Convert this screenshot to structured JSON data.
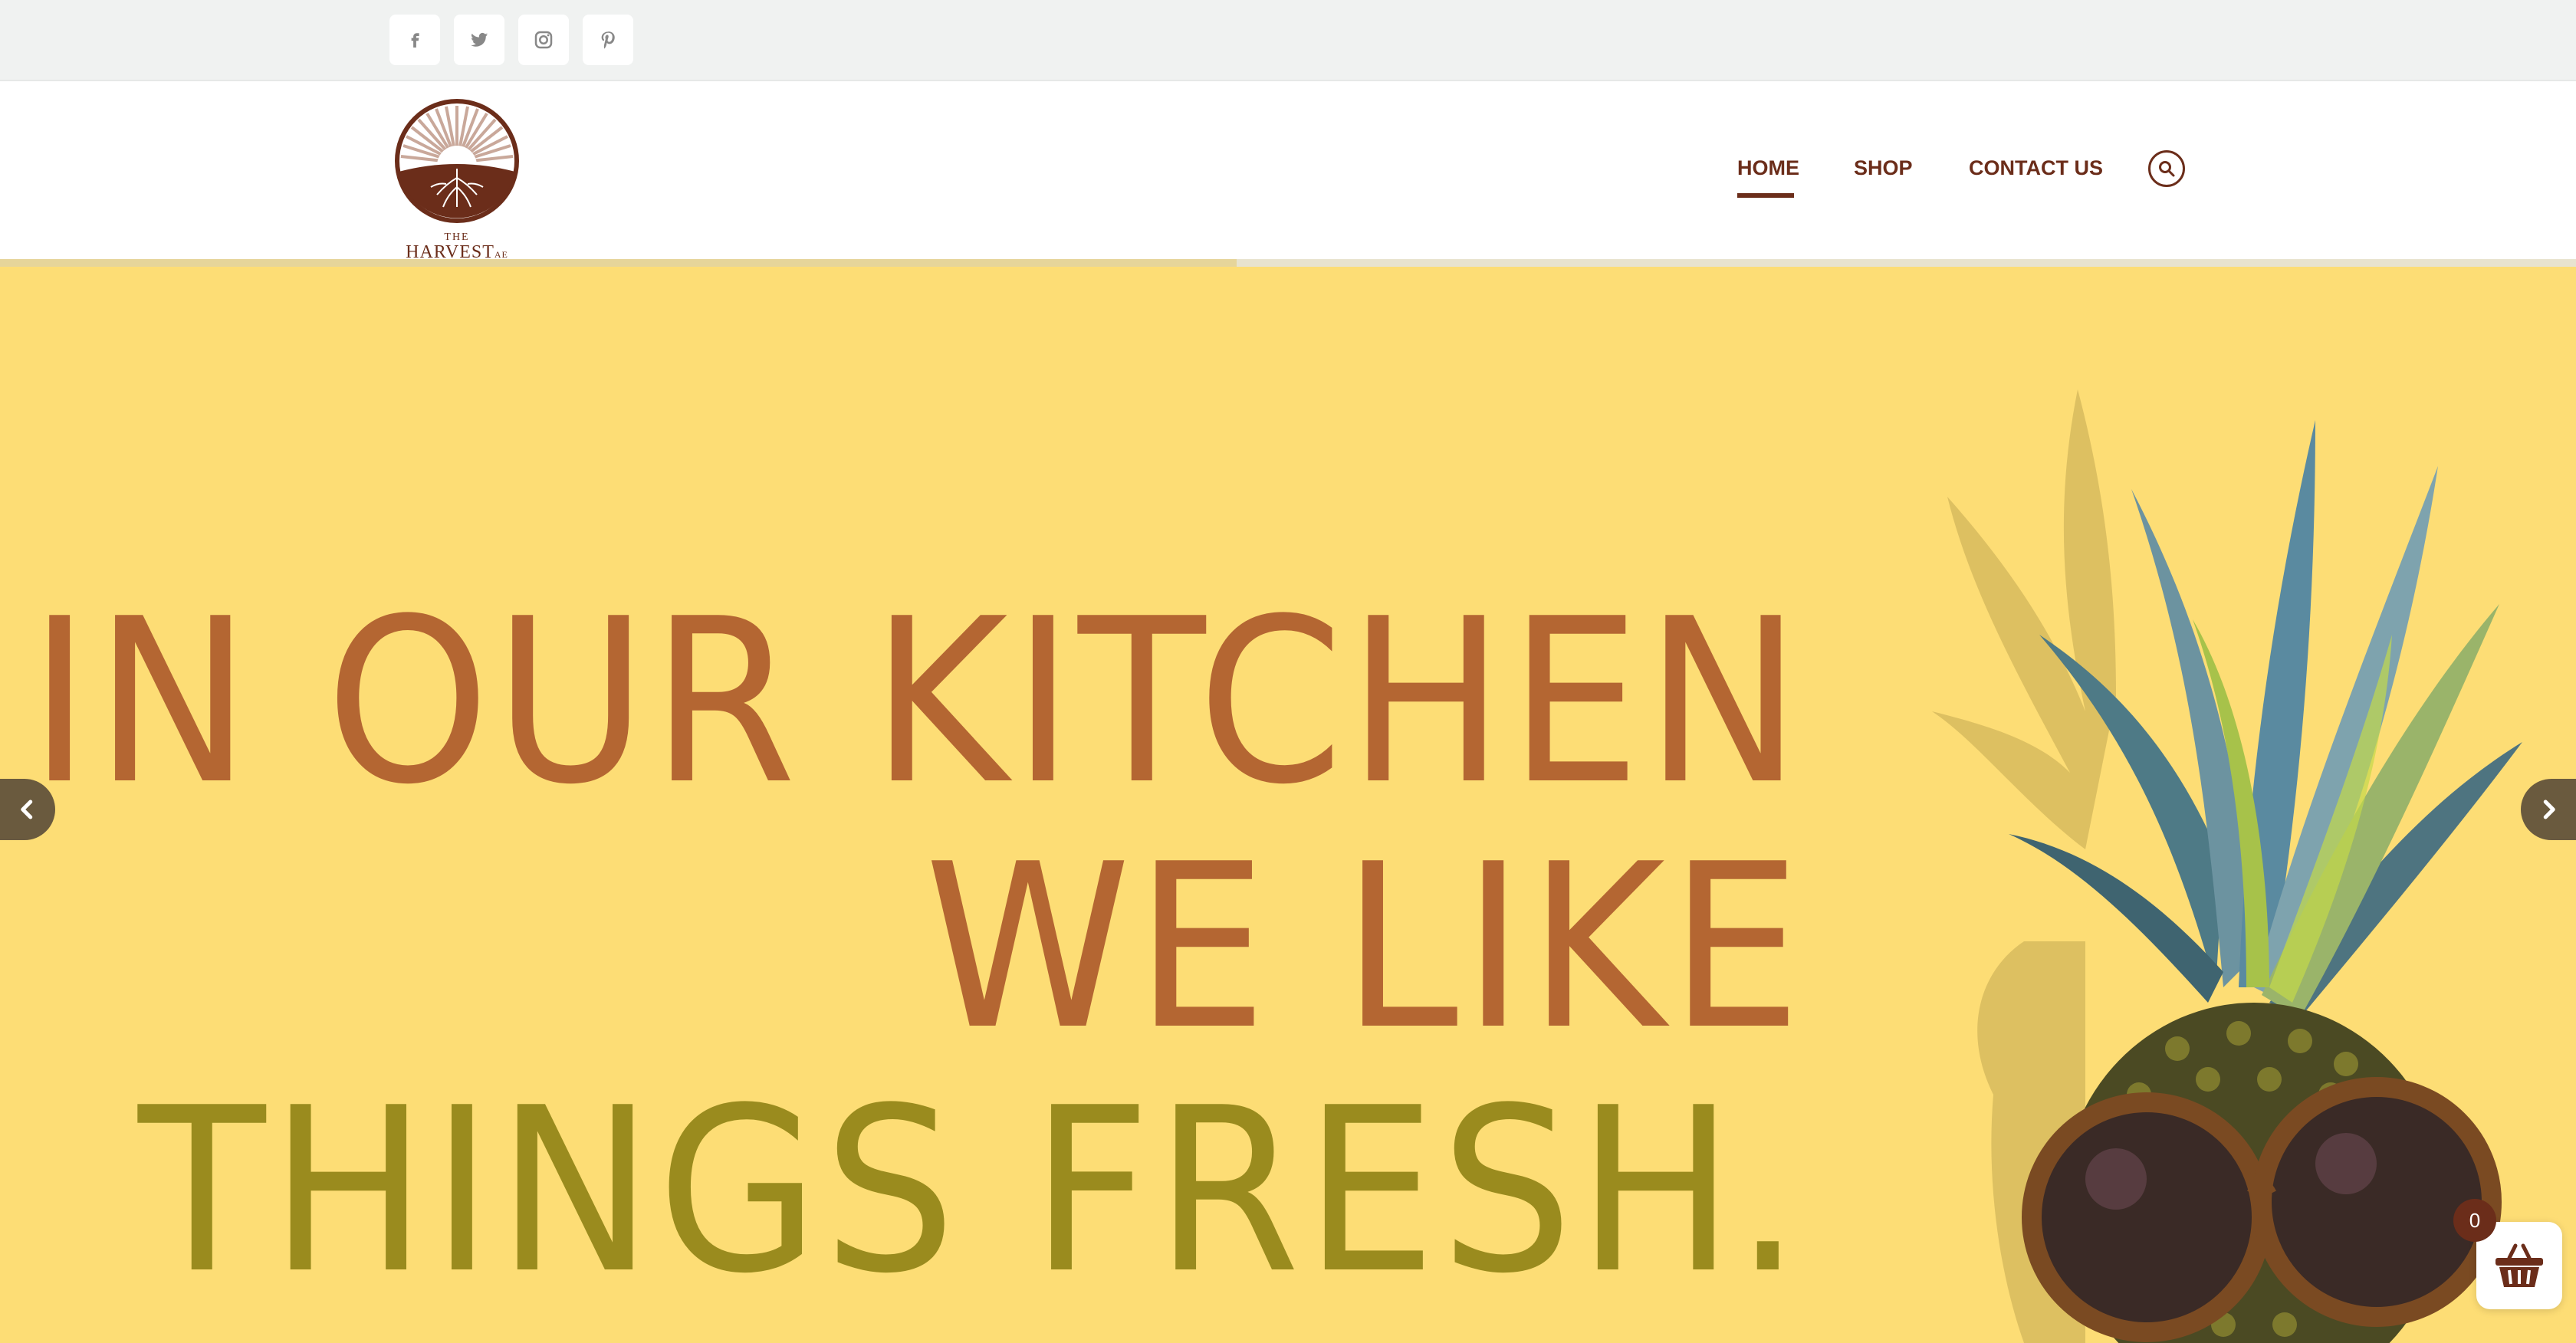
{
  "social": {
    "items": [
      {
        "name": "facebook",
        "icon": "facebook-icon"
      },
      {
        "name": "twitter",
        "icon": "twitter-icon"
      },
      {
        "name": "instagram",
        "icon": "instagram-icon"
      },
      {
        "name": "pinterest",
        "icon": "pinterest-icon"
      }
    ]
  },
  "header": {
    "logo_top": "THE",
    "logo_name": "HARVEST",
    "logo_suffix": "AE",
    "nav": [
      {
        "label": "HOME",
        "active": true
      },
      {
        "label": "SHOP",
        "active": false
      },
      {
        "label": "CONTACT US",
        "active": false
      }
    ],
    "search_icon": "search-icon"
  },
  "slider": {
    "progress": 0.48,
    "headline_line1": "IN OUR KITCHEN",
    "headline_line2": "WE LIKE",
    "headline_line3": "THINGS FRESH.",
    "prev_icon": "chevron-left-icon",
    "next_icon": "chevron-right-icon"
  },
  "cart": {
    "count": "0",
    "icon": "basket-icon"
  },
  "colors": {
    "brand_brown": "#6b2d1a",
    "hero_bg": "#fddd75",
    "headline_orange": "#b46632",
    "headline_olive": "#9a8b1e",
    "topbar_bg": "#f0f2f1"
  }
}
